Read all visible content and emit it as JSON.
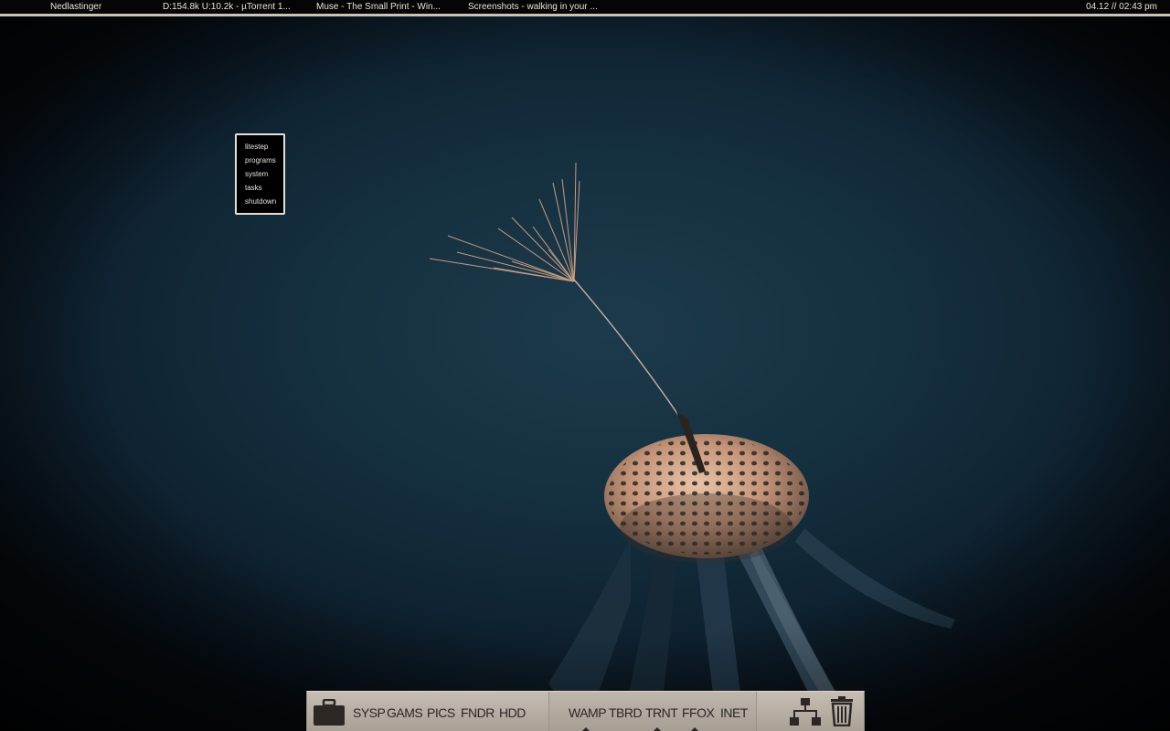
{
  "topbar": {
    "tasks": [
      "Nedlastinger",
      "D:154.8k U:10.2k - µTorrent 1...",
      "Muse - The Small Print - Win...",
      "Screenshots - walking in your ..."
    ],
    "clock": "04.12 // 02:43 pm"
  },
  "popup_menu": {
    "items": [
      "litestep",
      "programs",
      "system",
      "tasks",
      "shutdown"
    ]
  },
  "dock": {
    "left_icon": "briefcase-icon",
    "left_labels": [
      "SYSP",
      "GAMS",
      "PICS",
      "FNDR",
      "HDD"
    ],
    "running_labels": [
      "WAMP",
      "TBRD",
      "TRNT",
      "FFOX",
      "INET"
    ],
    "right_icons": [
      "network-icon",
      "trash-icon"
    ]
  },
  "colors": {
    "taskbar_bg": "#050505",
    "taskbar_text": "#e8e2d8",
    "taskbar_border": "#c9c3b8",
    "dock_bg": "#b8afa5",
    "dock_text": "#2a2724",
    "wallpaper_bg": "#15303f",
    "seed_color": "#d9a888"
  }
}
